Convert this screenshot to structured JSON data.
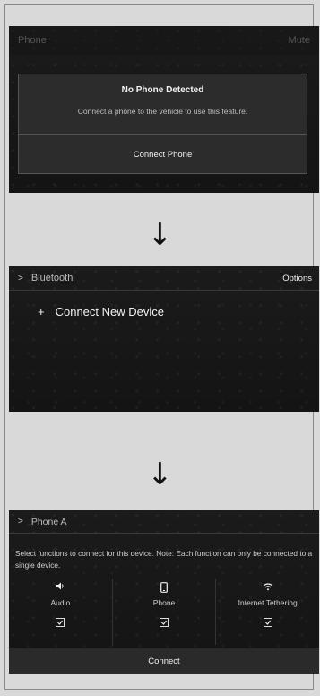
{
  "screen1": {
    "topbar_title": "Phone",
    "topbar_right": "Mute",
    "dialog_title": "No Phone Detected",
    "dialog_message": "Connect a phone to the vehicle to use this feature.",
    "dialog_button": "Connect Phone"
  },
  "arrow": "↓",
  "screen2": {
    "chevron": ">",
    "title": "Bluetooth",
    "options": "Options",
    "item_plus": "+",
    "item_label": "Connect New Device"
  },
  "screen3": {
    "chevron": ">",
    "title": "Phone A",
    "description": "Select functions to connect for this device. Note: Each function can only be connected to a single device.",
    "functions": [
      {
        "name": "Audio",
        "icon": "speaker-icon",
        "checked": true
      },
      {
        "name": "Phone",
        "icon": "phone-icon",
        "checked": true
      },
      {
        "name": "Internet Tethering",
        "icon": "wifi-icon",
        "checked": true
      }
    ],
    "connect_label": "Connect"
  },
  "colors": {
    "screen_bg": "#161616",
    "page_bg": "#d9d9d9",
    "text": "#e8e8e8"
  }
}
